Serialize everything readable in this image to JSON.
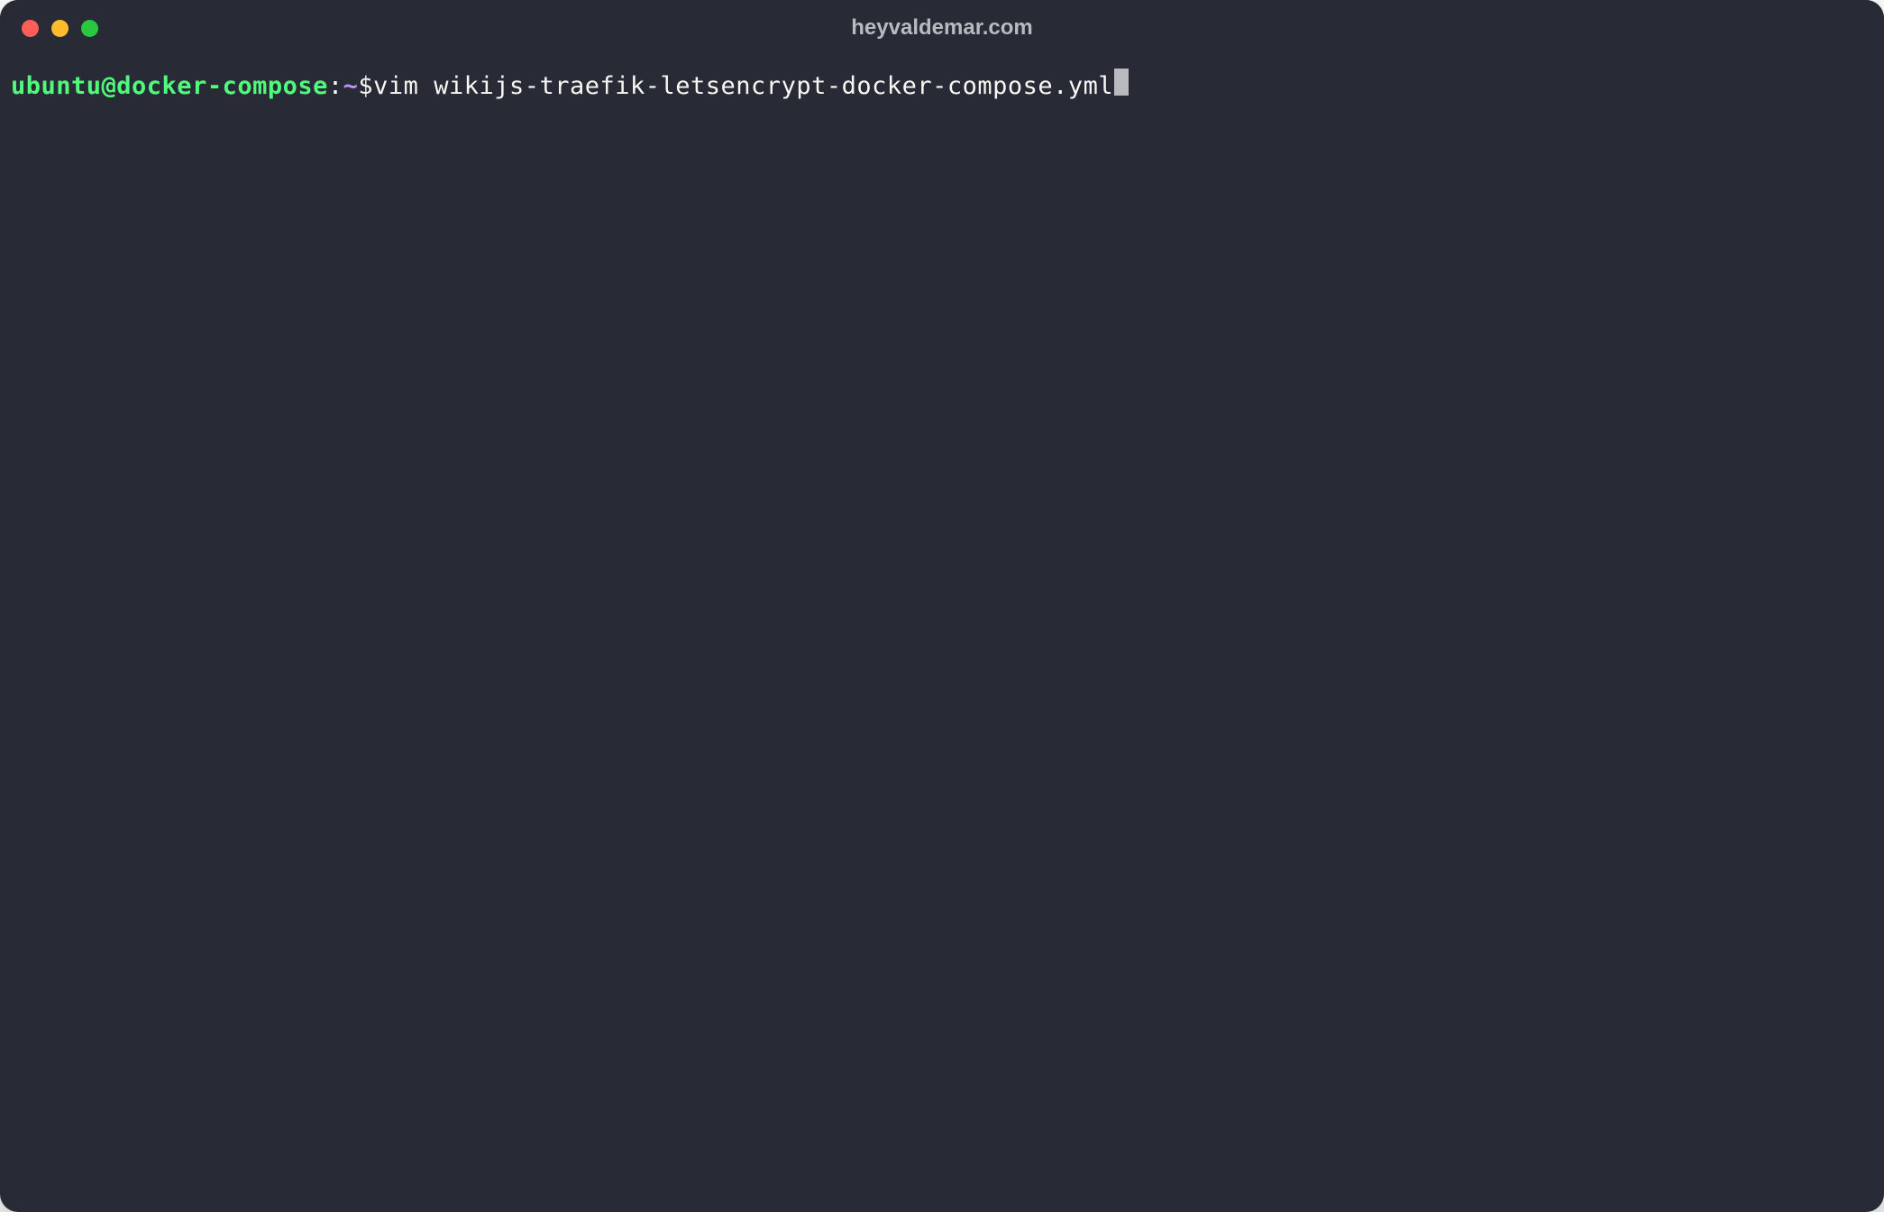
{
  "window": {
    "title": "heyvaldemar.com"
  },
  "prompt": {
    "user_host": "ubuntu@docker-compose",
    "colon": ":",
    "path": "~",
    "symbol": "$"
  },
  "command": {
    "text": " vim wikijs-traefik-letsencrypt-docker-compose.yml"
  },
  "colors": {
    "background": "#282a36",
    "foreground": "#f8f8f2",
    "prompt_user": "#50fa7b",
    "prompt_path": "#bd93f9",
    "traffic_close": "#ff5f57",
    "traffic_minimize": "#febc2e",
    "traffic_maximize": "#28c840"
  }
}
